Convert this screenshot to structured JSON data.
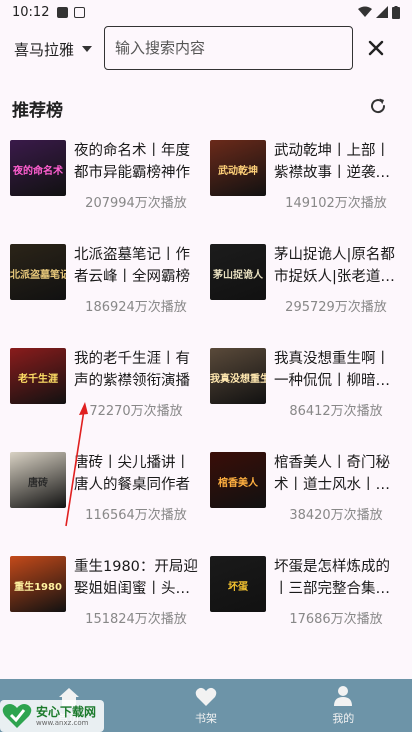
{
  "status_bar": {
    "time": "10:12"
  },
  "header": {
    "platform": "喜马拉雅",
    "search_placeholder": "输入搜索内容"
  },
  "section": {
    "title": "推荐榜"
  },
  "items": [
    {
      "title": "夜的命名术丨年度都市异能霸榜神作",
      "plays": "207994万次播放",
      "cover_text": "夜的命名术",
      "cover_bg": "#3a1a4a",
      "cover_fg": "#ff5fd0"
    },
    {
      "title": "武动乾坤丨上部丨紫襟故事丨逆袭丨修仙",
      "plays": "149102万次播放",
      "cover_text": "武动乾坤",
      "cover_bg": "#6b2a1a",
      "cover_fg": "#ffd27a"
    },
    {
      "title": "北派盗墓笔记丨作者云峰丨全网霸榜",
      "plays": "186924万次播放",
      "cover_text": "北派盗墓笔记",
      "cover_bg": "#2b2418",
      "cover_fg": "#e6c77a"
    },
    {
      "title": "茅山捉诡人|原名都市捉妖人|张老道传人",
      "plays": "295729万次播放",
      "cover_text": "茅山捉诡人",
      "cover_bg": "#1c1c1c",
      "cover_fg": "#e8e0c0"
    },
    {
      "title": "我的老千生涯丨有声的紫襟领衔演播",
      "plays": "72270万次播放",
      "cover_text": "老千生涯",
      "cover_bg": "#8a1c1c",
      "cover_fg": "#ffe066"
    },
    {
      "title": "我真没想重生啊丨一种侃侃丨柳暗花明",
      "plays": "86412万次播放",
      "cover_text": "我真没想重生啊",
      "cover_bg": "#5a4a3a",
      "cover_fg": "#ffe8b0"
    },
    {
      "title": "唐砖丨尖儿播讲丨唐人的餐桌同作者",
      "plays": "116564万次播放",
      "cover_text": "唐砖",
      "cover_bg": "#d9d2c4",
      "cover_fg": "#2a2a2a"
    },
    {
      "title": "棺香美人丨奇门秘术丨道士风水丨悬疑",
      "plays": "38420万次播放",
      "cover_text": "棺香美人",
      "cover_bg": "#3a0e08",
      "cover_fg": "#ffb040"
    },
    {
      "title": "重生1980：开局迎娶姐姐闺蜜丨头部主播",
      "plays": "151824万次播放",
      "cover_text": "重生1980",
      "cover_bg": "#c44a1a",
      "cover_fg": "#fff2a0"
    },
    {
      "title": "坏蛋是怎样炼成的丨三部完整合集丨六道",
      "plays": "17686万次播放",
      "cover_text": "坏蛋",
      "cover_bg": "#1a1a1a",
      "cover_fg": "#f0c030"
    }
  ],
  "bottom_nav": [
    {
      "label": "首页",
      "icon": "home-icon"
    },
    {
      "label": "书架",
      "icon": "heart-icon"
    },
    {
      "label": "我的",
      "icon": "person-icon"
    }
  ],
  "watermark": {
    "title": "安心下载网",
    "url": "www.anxz.com"
  },
  "colors": {
    "nav_bg": "#6d94a8",
    "page_bg": "#fdf7fc",
    "plays_text": "#888888"
  }
}
